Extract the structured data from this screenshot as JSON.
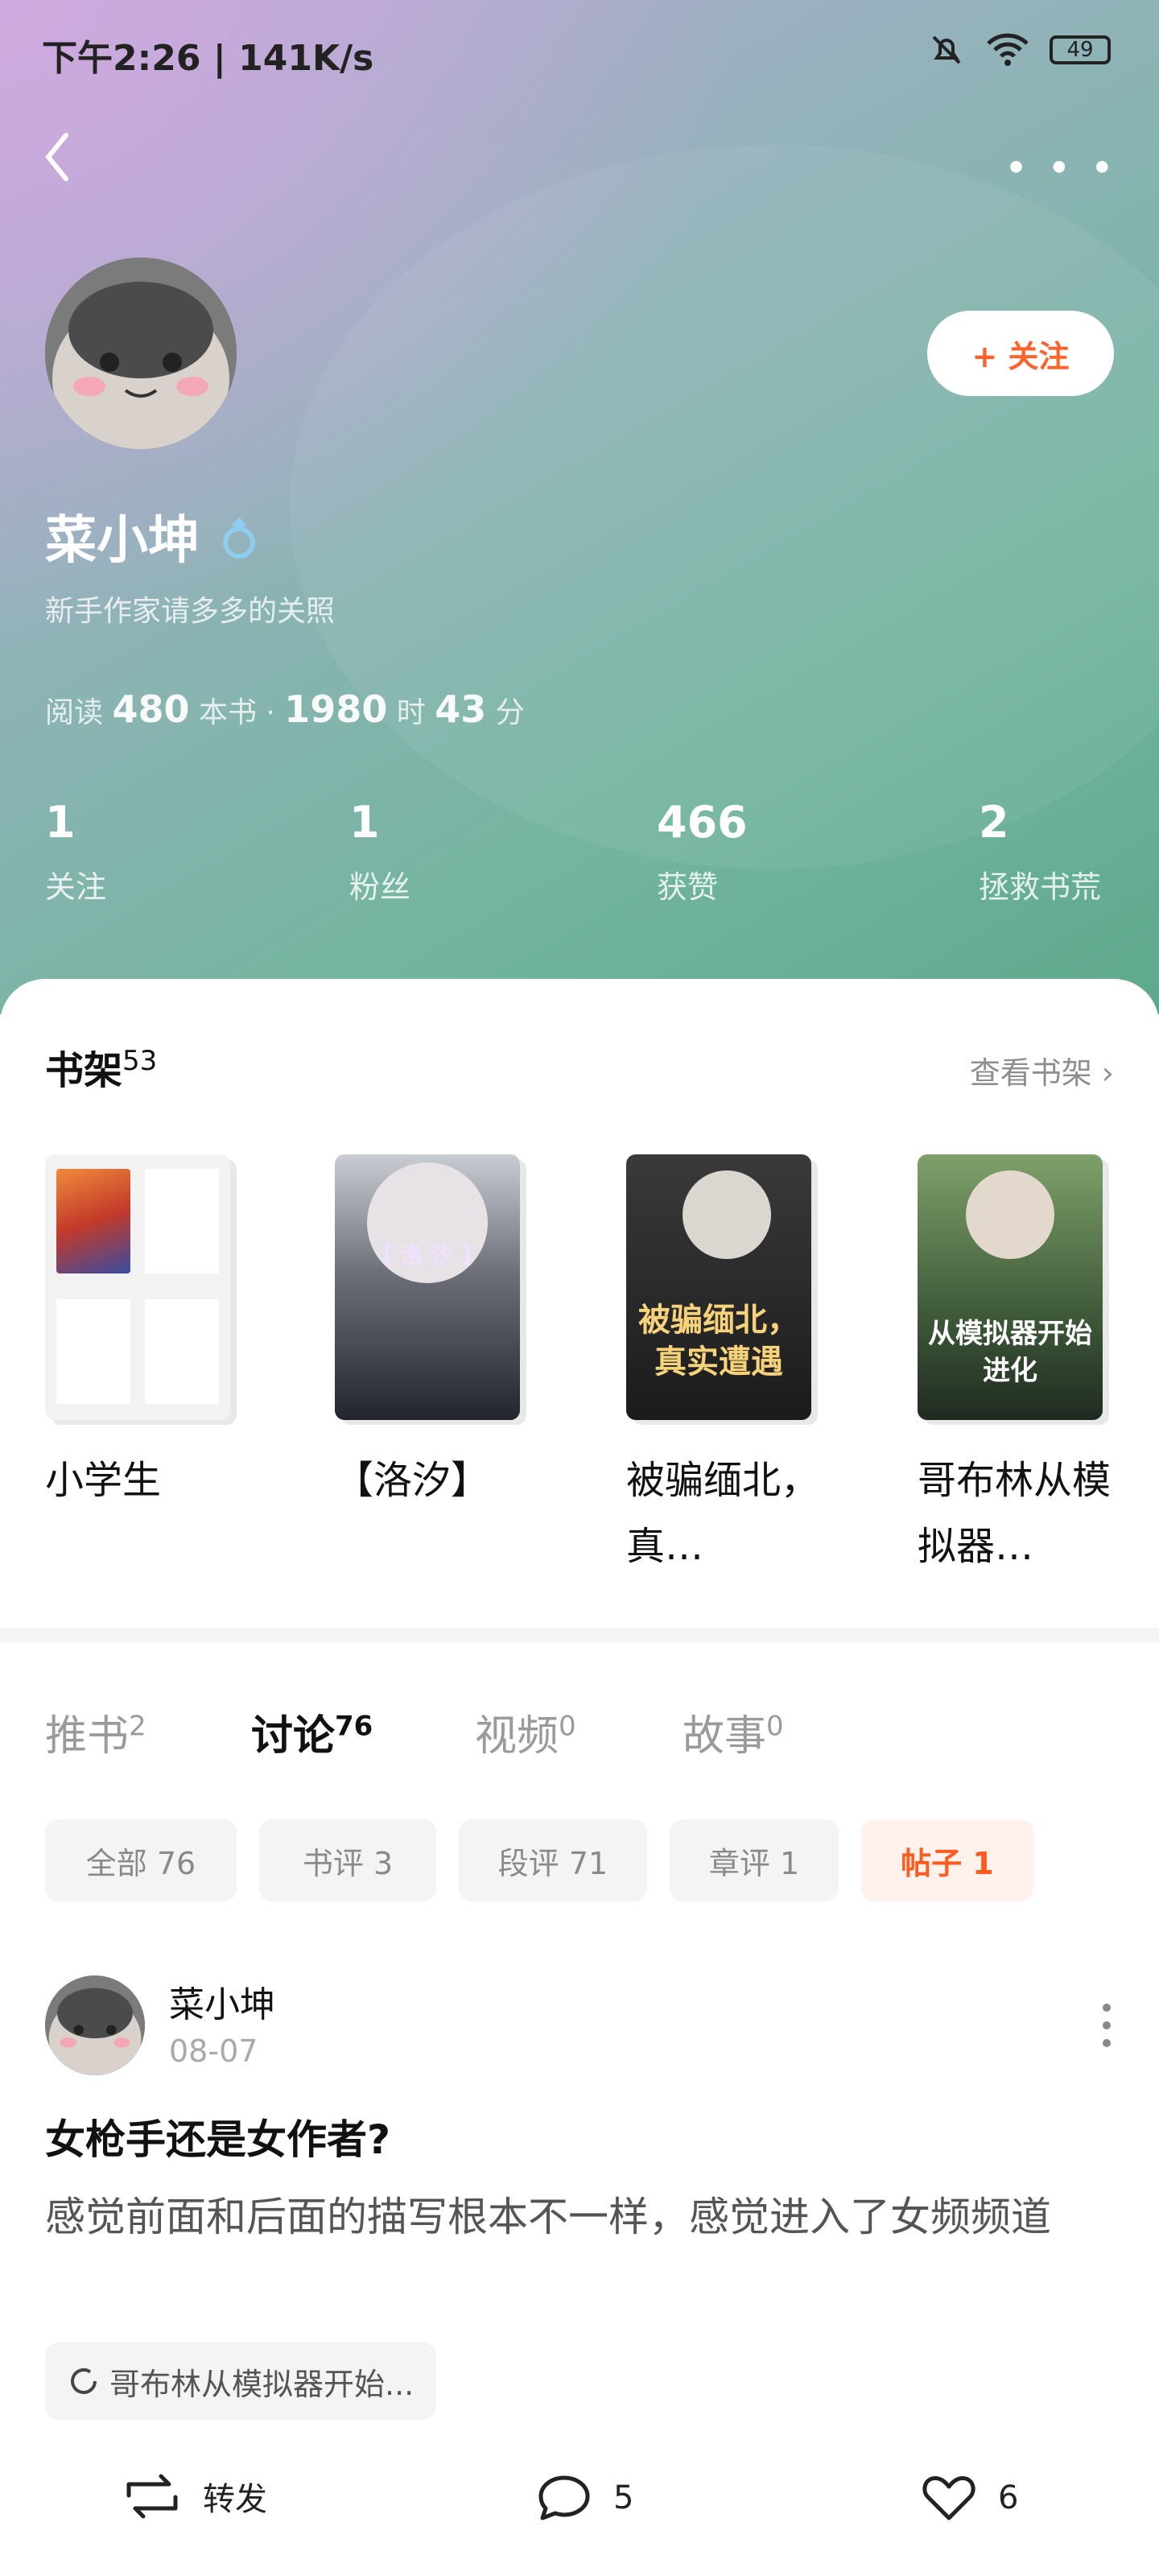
{
  "status_bar": {
    "time_speed": "下午2:26 | 141K/s",
    "battery": "49"
  },
  "header": {
    "follow_label": "+ 关注",
    "username": "菜小坤",
    "bio": "新手作家请多多的关照",
    "reading": {
      "prefix": "阅读",
      "books": "480",
      "books_unit": "本书 ·",
      "hours": "1980",
      "hours_unit": "时",
      "minutes": "43",
      "minutes_unit": "分"
    },
    "stats": [
      {
        "value": "1",
        "label": "关注"
      },
      {
        "value": "1",
        "label": "粉丝"
      },
      {
        "value": "466",
        "label": "获赞"
      },
      {
        "value": "2",
        "label": "拯救书荒"
      }
    ]
  },
  "shelf": {
    "title": "书架",
    "count": "53",
    "link": "查看书架 ›",
    "books": [
      {
        "title": "小学生",
        "cover_text": ""
      },
      {
        "title": "【洛汐】",
        "cover_text": "【 洛  汐 】"
      },
      {
        "title": "被骗缅北，真…",
        "cover_text": "被骗缅北，真实遭遇"
      },
      {
        "title": "哥布林从模拟器…",
        "cover_text": "从模拟器开始进化"
      }
    ]
  },
  "tabs": [
    {
      "label": "推书",
      "count": "2"
    },
    {
      "label": "讨论",
      "count": "76"
    },
    {
      "label": "视频",
      "count": "0"
    },
    {
      "label": "故事",
      "count": "0"
    }
  ],
  "filters": [
    "全部 76",
    "书评 3",
    "段评 71",
    "章评 1",
    "帖子 1"
  ],
  "post": {
    "user": "菜小坤",
    "date": "08-07",
    "title": "女枪手还是女作者?",
    "body": "感觉前面和后面的描写根本不一样，感觉进入了女频频道",
    "book_ref": "哥布林从模拟器开始...",
    "actions": {
      "repost": "转发",
      "comments": "5",
      "likes": "6"
    }
  }
}
